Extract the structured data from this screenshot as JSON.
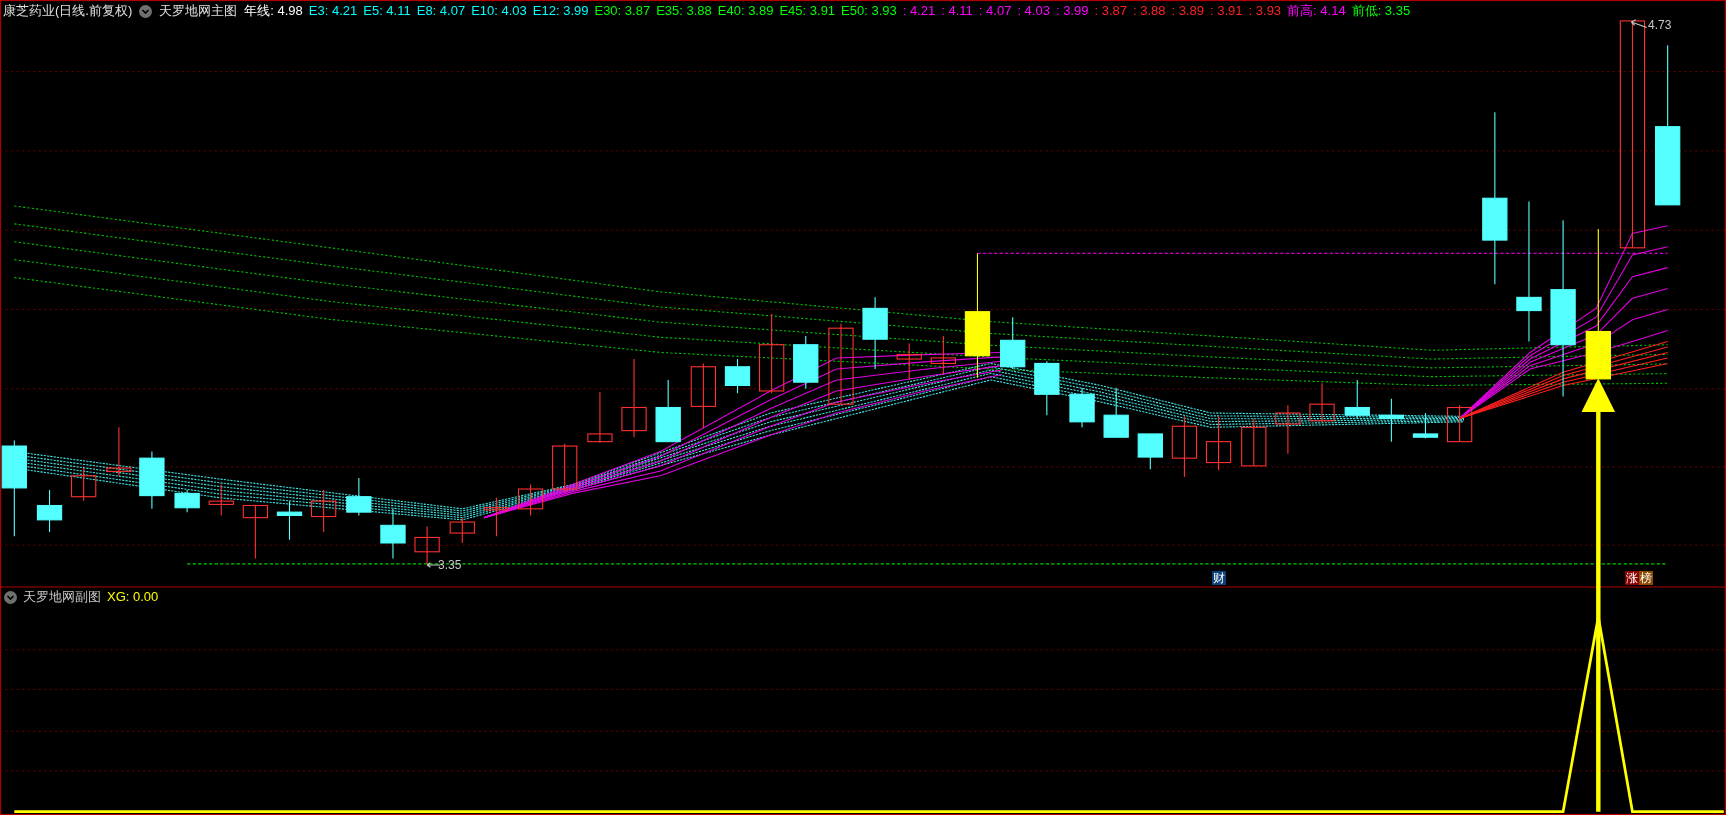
{
  "main_panel": {
    "stock_name": "康芝药业(日线.前复权)",
    "indicator_name": "天罗地网主图",
    "legend": [
      {
        "text": "年线: 4.98",
        "color": "#ffffff"
      },
      {
        "text": "E3: 4.21",
        "color": "#00ffff"
      },
      {
        "text": "E5: 4.11",
        "color": "#00ffff"
      },
      {
        "text": "E8: 4.07",
        "color": "#00ffff"
      },
      {
        "text": "E10: 4.03",
        "color": "#00ffff"
      },
      {
        "text": "E12: 3.99",
        "color": "#00ffff"
      },
      {
        "text": "E30: 3.87",
        "color": "#00ff00"
      },
      {
        "text": "E35: 3.88",
        "color": "#00ff00"
      },
      {
        "text": "E40: 3.89",
        "color": "#00ff00"
      },
      {
        "text": "E45: 3.91",
        "color": "#00ff00"
      },
      {
        "text": "E50: 3.93",
        "color": "#00ff00"
      },
      {
        "text": ": 4.21",
        "color": "#ff00ff"
      },
      {
        "text": ": 4.11",
        "color": "#ff00ff"
      },
      {
        "text": ": 4.07",
        "color": "#ff00ff"
      },
      {
        "text": ": 4.03",
        "color": "#ff00ff"
      },
      {
        "text": ": 3.99",
        "color": "#ff00ff"
      },
      {
        "text": ": 3.87",
        "color": "#ff2020"
      },
      {
        "text": ": 3.88",
        "color": "#ff2020"
      },
      {
        "text": ": 3.89",
        "color": "#ff2020"
      },
      {
        "text": ": 3.91",
        "color": "#ff2020"
      },
      {
        "text": ": 3.93",
        "color": "#ff2020"
      },
      {
        "text": "前高: 4.14",
        "color": "#ff00ff"
      },
      {
        "text": "前低: 3.35",
        "color": "#00ff00"
      }
    ],
    "price_labels": [
      {
        "text": "4.73"
      },
      {
        "text": "3.35"
      }
    ],
    "event_markers": [
      {
        "text": "财",
        "color": "#0a3f7a"
      },
      {
        "text": "涨",
        "color": "#8a0000"
      },
      {
        "text": "榜",
        "color": "#8a4a00"
      }
    ]
  },
  "sub_panel": {
    "indicator_name": "天罗地网副图",
    "legend": [
      {
        "text": "XG: 0.00",
        "color": "#ffff00"
      }
    ]
  }
}
